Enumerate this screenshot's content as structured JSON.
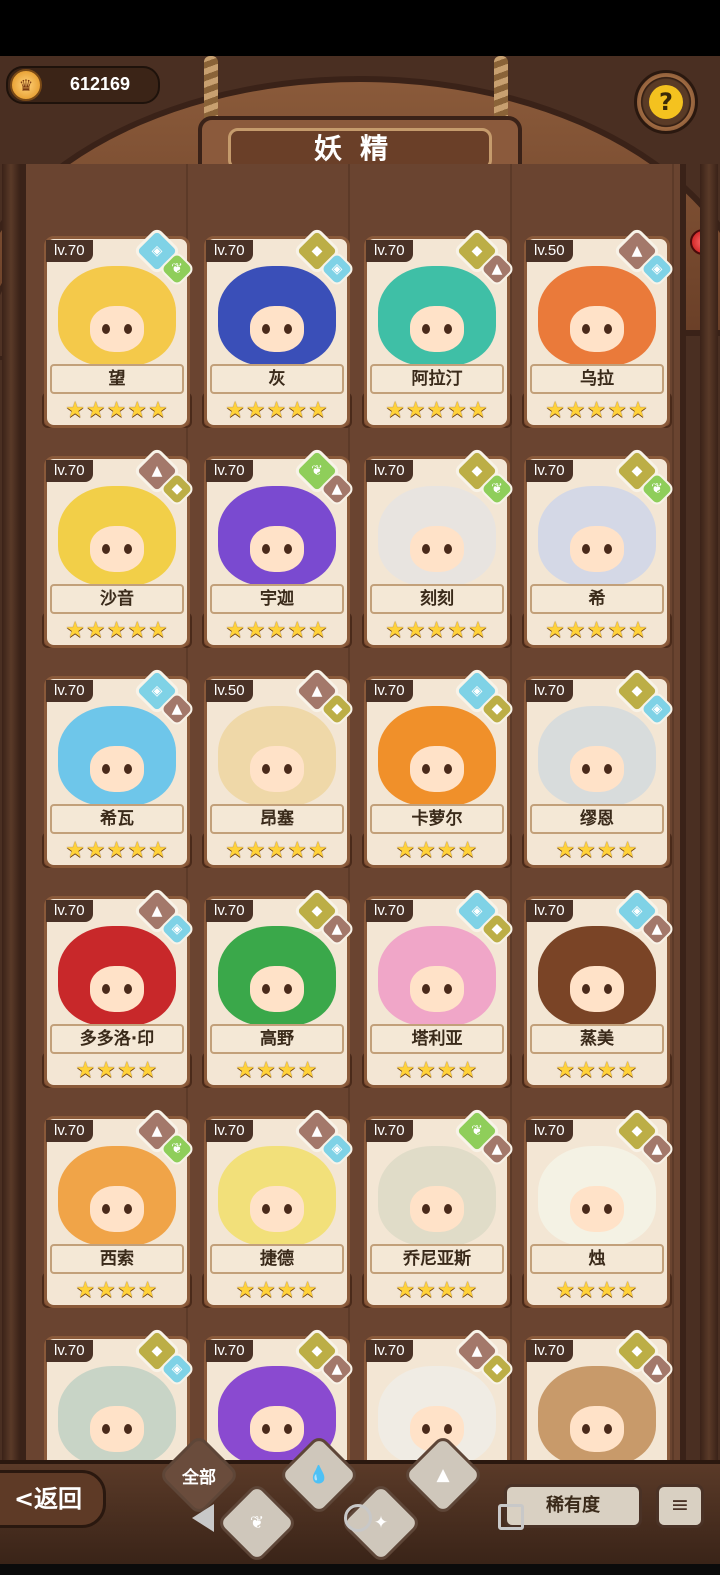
{
  "header": {
    "coins": "612169",
    "coin_icon": "crown-coin-icon",
    "title": "妖精",
    "help_icon": "question-sprout-icon"
  },
  "cards": [
    {
      "level": "lv.70",
      "name": "望",
      "stars": 5,
      "elements": [
        "water",
        "plant"
      ],
      "hair": "#f4c94a"
    },
    {
      "level": "lv.70",
      "name": "灰",
      "stars": 5,
      "elements": [
        "earth",
        "water"
      ],
      "hair": "#3a4fb8"
    },
    {
      "level": "lv.70",
      "name": "阿拉汀",
      "stars": 5,
      "elements": [
        "earth",
        "fire"
      ],
      "hair": "#3fbfa6"
    },
    {
      "level": "lv.50",
      "name": "乌拉",
      "stars": 5,
      "elements": [
        "fire",
        "water"
      ],
      "hair": "#ea7a3a"
    },
    {
      "level": "lv.70",
      "name": "沙音",
      "stars": 5,
      "elements": [
        "fire",
        "earth"
      ],
      "hair": "#f2cf48"
    },
    {
      "level": "lv.70",
      "name": "宇迦",
      "stars": 5,
      "elements": [
        "plant",
        "fire"
      ],
      "hair": "#7a4ad0"
    },
    {
      "level": "lv.70",
      "name": "刻刻",
      "stars": 5,
      "elements": [
        "earth",
        "plant"
      ],
      "hair": "#e8e4e0"
    },
    {
      "level": "lv.70",
      "name": "希",
      "stars": 5,
      "elements": [
        "earth",
        "plant"
      ],
      "hair": "#d4d8e6"
    },
    {
      "level": "lv.70",
      "name": "希瓦",
      "stars": 5,
      "elements": [
        "water",
        "fire"
      ],
      "hair": "#6ec6ea"
    },
    {
      "level": "lv.50",
      "name": "昂塞",
      "stars": 5,
      "elements": [
        "fire",
        "earth"
      ],
      "hair": "#efd8a8"
    },
    {
      "level": "lv.70",
      "name": "卡萝尔",
      "stars": 4,
      "elements": [
        "water",
        "earth"
      ],
      "hair": "#f0902a"
    },
    {
      "level": "lv.70",
      "name": "缪恩",
      "stars": 4,
      "elements": [
        "earth",
        "water"
      ],
      "hair": "#d8dcdc"
    },
    {
      "level": "lv.70",
      "name": "多多洛·印",
      "stars": 4,
      "elements": [
        "fire",
        "water"
      ],
      "hair": "#c8282a"
    },
    {
      "level": "lv.70",
      "name": "高野",
      "stars": 4,
      "elements": [
        "earth",
        "fire"
      ],
      "hair": "#3aa84a"
    },
    {
      "level": "lv.70",
      "name": "塔利亚",
      "stars": 4,
      "elements": [
        "water",
        "earth"
      ],
      "hair": "#f0a6c8"
    },
    {
      "level": "lv.70",
      "name": "蒸美",
      "stars": 4,
      "elements": [
        "water",
        "fire"
      ],
      "hair": "#7a4426"
    },
    {
      "level": "lv.70",
      "name": "西索",
      "stars": 4,
      "elements": [
        "fire",
        "plant"
      ],
      "hair": "#f0a448"
    },
    {
      "level": "lv.70",
      "name": "捷德",
      "stars": 4,
      "elements": [
        "fire",
        "water"
      ],
      "hair": "#f2e07a"
    },
    {
      "level": "lv.70",
      "name": "乔尼亚斯",
      "stars": 4,
      "elements": [
        "plant",
        "fire"
      ],
      "hair": "#e0dcc8"
    },
    {
      "level": "lv.70",
      "name": "烛",
      "stars": 4,
      "elements": [
        "earth",
        "fire"
      ],
      "hair": "#f4f2e4"
    },
    {
      "level": "lv.70",
      "name": "",
      "stars": 0,
      "elements": [
        "earth",
        "water"
      ],
      "hair": "#c8d4c6"
    },
    {
      "level": "lv.70",
      "name": "",
      "stars": 0,
      "elements": [
        "earth",
        "fire"
      ],
      "hair": "#8a4ad0"
    },
    {
      "level": "lv.70",
      "name": "",
      "stars": 0,
      "elements": [
        "fire",
        "earth"
      ],
      "hair": "#f0ece4"
    },
    {
      "level": "lv.70",
      "name": "",
      "stars": 0,
      "elements": [
        "earth",
        "fire"
      ],
      "hair": "#c89a6a"
    }
  ],
  "bottom": {
    "back_label": "<返回",
    "tabs": [
      {
        "label": "全部",
        "icon": "all-icon",
        "active": true
      },
      {
        "label": "",
        "icon": "water-drop-icon",
        "active": false
      },
      {
        "label": "",
        "icon": "sprout-icon",
        "active": false
      },
      {
        "label": "",
        "icon": "mountain-icon",
        "active": false
      },
      {
        "label": "",
        "icon": "flame-icon",
        "active": false
      }
    ],
    "rarity_label": "稀有度",
    "sort_icon": "sort-descending-icon"
  },
  "colors": {
    "water": "#7fd2e6",
    "earth": "#bcae46",
    "plant": "#8fce5a",
    "fire": "#a3786a",
    "star": "#ffd23a"
  }
}
